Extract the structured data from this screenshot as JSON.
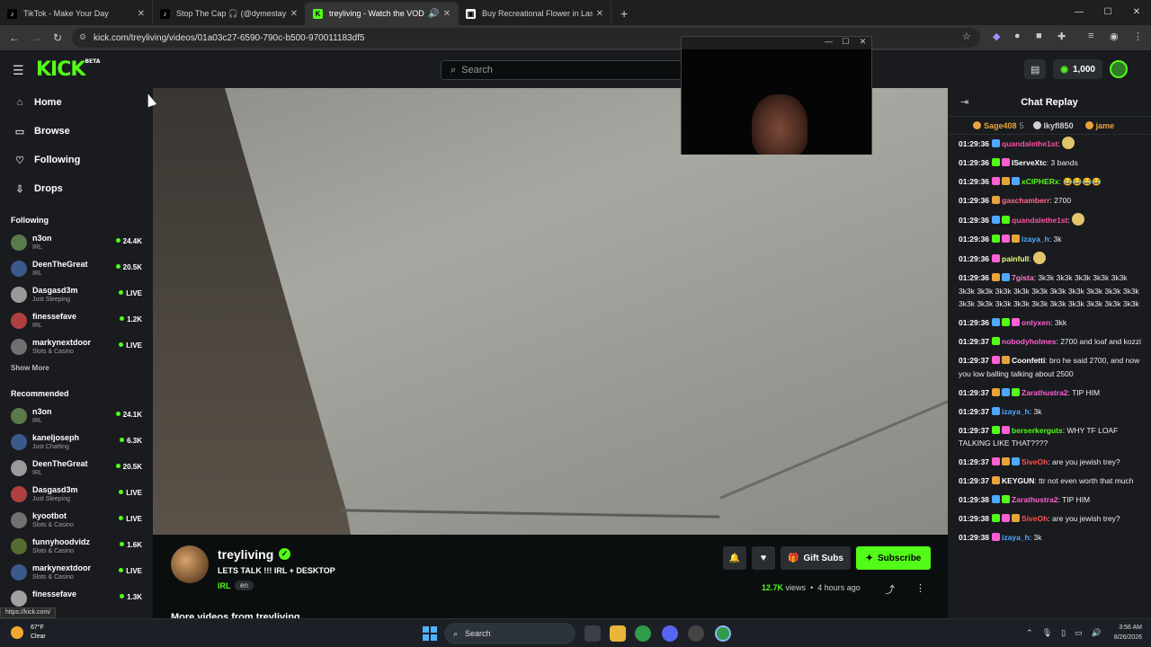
{
  "browser": {
    "tabs": [
      {
        "label": "TikTok - Make Your Day",
        "icon": "tiktok-icon",
        "active": false
      },
      {
        "label": "Stop The Cap 🎧 (@dymestay",
        "icon": "tiktok-icon",
        "active": false
      },
      {
        "label": "treyliving - Watch the VOD",
        "icon": "kick-icon",
        "active": true
      },
      {
        "label": "Buy Recreational Flower in Las",
        "icon": "store-icon",
        "active": false
      }
    ],
    "url": "kick.com/treyliving/videos/01a03c27-6590-790c-b500-970011183df5",
    "status_url": "https://kick.com/"
  },
  "header": {
    "logo": "KICK",
    "logo_badge": "BETA",
    "search_placeholder": "Search",
    "coins": "1,000"
  },
  "sidebar": {
    "nav": [
      {
        "label": "Home",
        "icon": "home-icon"
      },
      {
        "label": "Browse",
        "icon": "browse-icon"
      },
      {
        "label": "Following",
        "icon": "heart-icon"
      },
      {
        "label": "Drops",
        "icon": "drops-icon"
      }
    ],
    "following_title": "Following",
    "following": [
      {
        "name": "n3on",
        "category": "IRL",
        "value": "24.4K",
        "live_count": true
      },
      {
        "name": "DeenTheGreat",
        "category": "IRL",
        "value": "20.5K",
        "live_count": true
      },
      {
        "name": "Dasgasd3m",
        "category": "Just Sleeping",
        "value": "LIVE",
        "live_count": true
      },
      {
        "name": "finessefave",
        "category": "IRL",
        "value": "1.2K",
        "live_count": true
      },
      {
        "name": "markynextdoor",
        "category": "Slots & Casino",
        "value": "LIVE",
        "live_count": true
      }
    ],
    "show_more": "Show More",
    "recommended_title": "Recommended",
    "recommended": [
      {
        "name": "n3on",
        "category": "IRL",
        "value": "24.1K"
      },
      {
        "name": "kaneljoseph",
        "category": "Just Chatting",
        "value": "6.3K"
      },
      {
        "name": "DeenTheGreat",
        "category": "IRL",
        "value": "20.5K"
      },
      {
        "name": "Dasgasd3m",
        "category": "Just Sleeping",
        "value": "LIVE"
      },
      {
        "name": "kyootbot",
        "category": "Slots & Casino",
        "value": "LIVE"
      },
      {
        "name": "funnyhoodvidz",
        "category": "Slots & Casino",
        "value": "1.6K"
      },
      {
        "name": "markynextdoor",
        "category": "Slots & Casino",
        "value": "LIVE"
      },
      {
        "name": "finessefave",
        "category": "",
        "value": "1.3K"
      }
    ]
  },
  "stream": {
    "streamer": "treyliving",
    "title": "LETS TALK !!! IRL + DESKTOP",
    "category": "IRL",
    "language": "en",
    "gift_label": "Gift Subs",
    "subscribe_label": "Subscribe",
    "views_count": "12.7K",
    "views_word": "views",
    "ago": "4 hours ago",
    "more_videos": "More videos from treyliving"
  },
  "chat": {
    "title": "Chat Replay",
    "gifters": [
      {
        "name": "Sage408",
        "count": "5",
        "color": "#e8a33a"
      },
      {
        "name": "lkyfl850",
        "count": "",
        "color": "#cfcfcf"
      },
      {
        "name": "jame",
        "count": "",
        "color": "#e8a33a"
      }
    ],
    "messages": [
      {
        "ts": "01:29:36",
        "user": "quandalethe1st",
        "color": "#ff4fa0",
        "text": ":",
        "emote": true
      },
      {
        "ts": "01:29:36",
        "user": "IServeXtc",
        "color": "#ffffff",
        "text": ": 3 bands",
        "emote": false
      },
      {
        "ts": "01:29:36",
        "user": "xCIPHERx",
        "color": "#53fc18",
        "text": ": 😂😂😂😂",
        "emote": false
      },
      {
        "ts": "01:29:36",
        "user": "gaschamberr",
        "color": "#ff6b8b",
        "text": ": 2700",
        "emote": false
      },
      {
        "ts": "01:29:36",
        "user": "quandalethe1st",
        "color": "#ff4fa0",
        "text": ":",
        "emote": true
      },
      {
        "ts": "01:29:36",
        "user": "izaya_h",
        "color": "#4fa8ff",
        "text": ": 3k",
        "emote": false
      },
      {
        "ts": "01:29:36",
        "user": "painfull",
        "color": "#e9ff7a",
        "text": ":",
        "emote": true
      },
      {
        "ts": "01:29:36",
        "user": "7gista",
        "color": "#ff7ac8",
        "text": ": 3k3k 3k3k 3k3k 3k3k 3k3k 3k3k 3k3k 3k3k 3k3k 3k3k 3k3k 3k3k 3k3k 3k3k 3k3k 3k3k 3k3k 3k3k 3k3k 3k3k 3k3k 3k3k 3k3k 3k3k 3k3k",
        "emote": false
      },
      {
        "ts": "01:29:36",
        "user": "onlyxen",
        "color": "#ff5fd2",
        "text": ": 3kk",
        "emote": false
      },
      {
        "ts": "01:29:37",
        "user": "nobodyholmes",
        "color": "#ff5fd2",
        "text": ": 2700 and loaf and kozzi",
        "emote": false
      },
      {
        "ts": "01:29:37",
        "user": "Coonfetti",
        "color": "#ffffff",
        "text": ": bro he said 2700, and now you low balling talking about 2500",
        "emote": false
      },
      {
        "ts": "01:29:37",
        "user": "Zarathustra2",
        "color": "#ff5fd2",
        "text": ": TIP HIM",
        "emote": false
      },
      {
        "ts": "01:29:37",
        "user": "izaya_h",
        "color": "#4fa8ff",
        "text": ": 3k",
        "emote": false
      },
      {
        "ts": "01:29:37",
        "user": "berserkerguts",
        "color": "#53fc18",
        "text": ": WHY TF LOAF TALKING LIKE THAT????",
        "emote": false
      },
      {
        "ts": "01:29:37",
        "user": "SiveOh",
        "color": "#ff5050",
        "text": ": are you jewish trey?",
        "emote": false
      },
      {
        "ts": "01:29:37",
        "user": "KEYGUN",
        "color": "#ffffff",
        "text": ": ttr not even worth that much",
        "emote": false
      },
      {
        "ts": "01:29:38",
        "user": "Zarathustra2",
        "color": "#ff5fd2",
        "text": ": TIP HIM",
        "emote": false
      },
      {
        "ts": "01:29:38",
        "user": "SiveOh",
        "color": "#ff5050",
        "text": ": are you jewish trey?",
        "emote": false
      },
      {
        "ts": "01:29:38",
        "user": "izaya_h",
        "color": "#4fa8ff",
        "text": ": 3k",
        "emote": false
      }
    ]
  },
  "taskbar": {
    "temp": "67°F",
    "weather": "Clear",
    "search": "Search",
    "time": "3:56 AM",
    "date": "8/26/2026"
  }
}
